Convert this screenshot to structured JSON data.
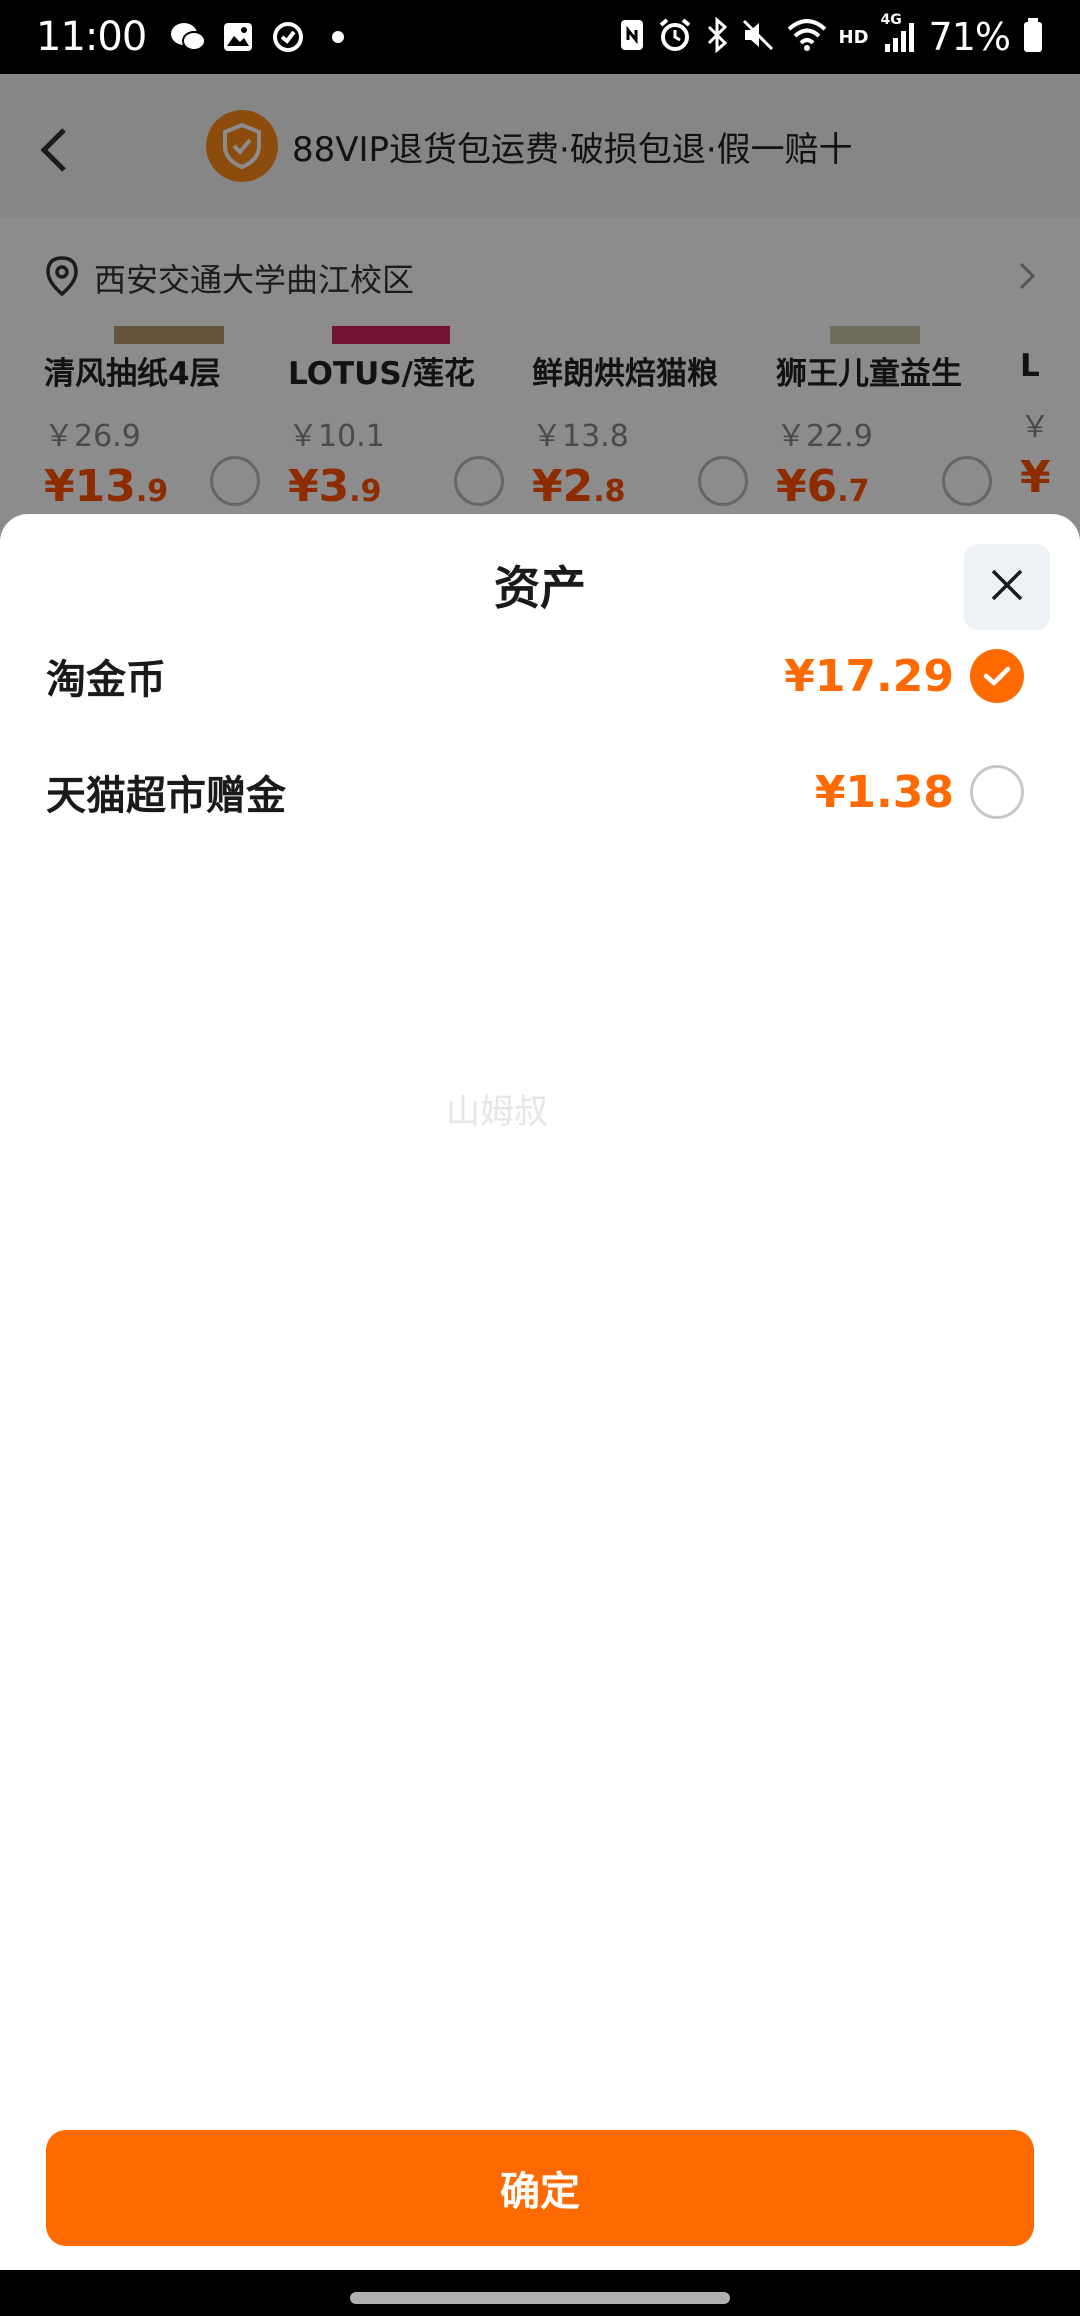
{
  "status_bar": {
    "time": "11:00",
    "battery": "71%",
    "network": "HD",
    "signal": "4G"
  },
  "background_page": {
    "banner": "88VIP退货包运费·破损包退·假一赔十",
    "address": "西安交通大学曲江校区",
    "products": [
      {
        "name": "清风抽纸4层",
        "original_price": "￥26.9",
        "sale_int": "¥13",
        "sale_dec": ".9"
      },
      {
        "name": "LOTUS/莲花",
        "original_price": "￥10.1",
        "sale_int": "¥3",
        "sale_dec": ".9"
      },
      {
        "name": "鲜朗烘焙猫粮",
        "original_price": "￥13.8",
        "sale_int": "¥2",
        "sale_dec": ".8"
      },
      {
        "name": "狮王儿童益生",
        "original_price": "￥22.9",
        "sale_int": "¥6",
        "sale_dec": ".7"
      },
      {
        "name": "L",
        "original_price": "￥",
        "sale_int": "¥",
        "sale_dec": ""
      }
    ]
  },
  "sheet": {
    "title": "资产",
    "assets": [
      {
        "label": "淘金币",
        "amount": "¥17.29",
        "selected": true
      },
      {
        "label": "天猫超市赠金",
        "amount": "¥1.38",
        "selected": false
      }
    ],
    "watermark": "山姆叔",
    "confirm_label": "确定"
  },
  "colors": {
    "accent": "#ff6a00",
    "close_bg": "#eef1f6"
  }
}
